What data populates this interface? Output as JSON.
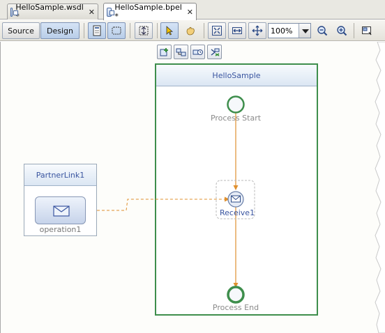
{
  "tabs": [
    {
      "label": "HelloSample.wsdl *",
      "active": false
    },
    {
      "label": "HelloSample.bpel *",
      "active": true
    }
  ],
  "tab_close_glyph": "✕",
  "toolbar": {
    "source_label": "Source",
    "design_label": "Design",
    "zoom_value": "100%",
    "icons": [
      "palette-toggle-icon",
      "selection-box-icon",
      "expand-all-icon",
      "select-arrow-icon",
      "hand-pan-icon",
      "fit-diagram-icon",
      "fit-width-icon",
      "fit-height-icon",
      "zoom-dropdown-arrow-icon",
      "zoom-out-icon",
      "zoom-in-icon",
      "navigator-icon"
    ]
  },
  "diagram": {
    "process_name": "HelloSample",
    "start_label": "Process Start",
    "end_label": "Process End",
    "receive_label": "Receive1",
    "partner_link_name": "PartnerLink1",
    "operation_label": "operation1"
  },
  "colors": {
    "process_border": "#3e8e4c",
    "header_text": "#3a55a0",
    "flow_line": "#e0902e",
    "node_label": "#8a8a8a"
  }
}
